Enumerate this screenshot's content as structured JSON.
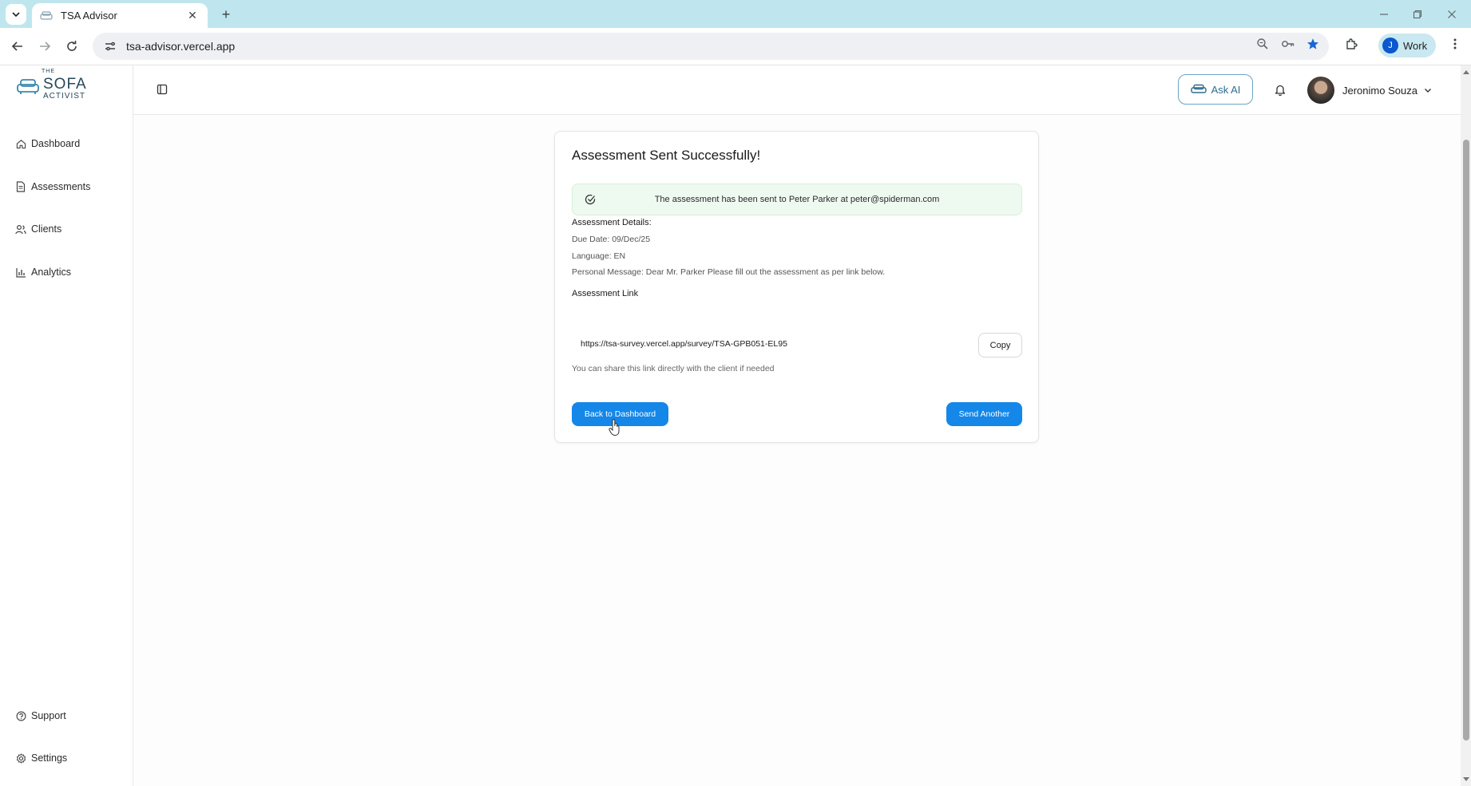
{
  "browser": {
    "tab_title": "TSA Advisor",
    "tab_close": "✕",
    "new_tab": "+",
    "url": "tsa-advisor.vercel.app",
    "profile_initial": "J",
    "profile_label": "Work"
  },
  "app": {
    "logo": {
      "the": "THE",
      "sofa": "SOFA",
      "activist": "ACTIVIST"
    },
    "sidebar": {
      "items": [
        {
          "label": "Dashboard",
          "icon": "home-icon"
        },
        {
          "label": "Assessments",
          "icon": "document-icon"
        },
        {
          "label": "Clients",
          "icon": "users-icon"
        },
        {
          "label": "Analytics",
          "icon": "bar-chart-icon"
        }
      ],
      "bottom_items": [
        {
          "label": "Support",
          "icon": "help-circle-icon"
        },
        {
          "label": "Settings",
          "icon": "gear-icon"
        }
      ]
    },
    "header": {
      "ask_ai_label": "Ask AI",
      "user_name": "Jeronimo Souza"
    },
    "card": {
      "title": "Assessment Sent Successfully!",
      "alert_text": "The assessment has been sent to Peter Parker at peter@spiderman.com",
      "details_heading": "Assessment Details:",
      "due_date": "Due Date: 09/Dec/25",
      "language": "Language: EN",
      "personal_message": "Personal Message: Dear Mr. Parker Please fill out the assessment as per link below.",
      "link_heading": "Assessment Link",
      "link_url": "https://tsa-survey.vercel.app/survey/TSA-GPB051-EL95",
      "copy_label": "Copy",
      "share_note": "You can share this link directly with the client if needed",
      "back_label": "Back to Dashboard",
      "send_another_label": "Send Another"
    }
  },
  "colors": {
    "tabbar": "#bfe6ef",
    "primary_button": "#1487e8",
    "success_bg": "#eefaf0",
    "brand": "#27485a"
  }
}
